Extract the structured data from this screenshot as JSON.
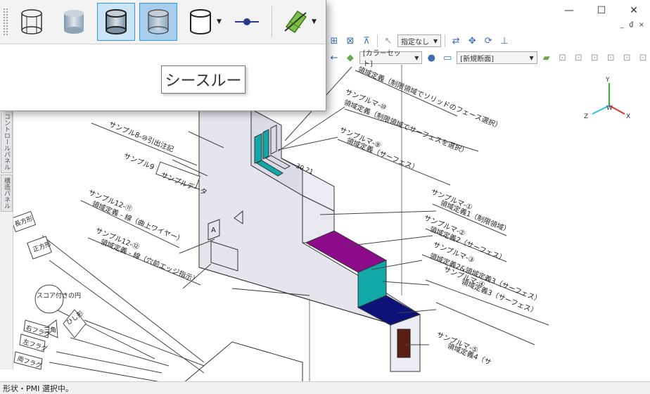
{
  "window": {
    "minimize": "—",
    "maximize": "☐",
    "close": "✕",
    "inner_controls": "_ ₫ ×"
  },
  "toolbar": {
    "specify_dropdown": "指定なし",
    "color_set": "[カラーセット]",
    "new_section": "[新規断面]"
  },
  "popup": {
    "tooltip": "シースルー",
    "buttons": [
      {
        "name": "wireframe",
        "active": false
      },
      {
        "name": "shaded",
        "active": false
      },
      {
        "name": "shaded-with-edges",
        "active": true
      },
      {
        "name": "see-through",
        "active": true
      }
    ]
  },
  "side_panel": {
    "tabs": [
      "コントロールパネル",
      "構造パネル"
    ]
  },
  "drawing": {
    "labels": [
      "領域定義（制限領域でソリッドのフェース選択）",
      "サンプルマ-⑩",
      "領域定義（制限領域でサーフェスを選択）",
      "サンプルマ-⑨",
      "領域定義（サーフェス）",
      "サンプル8-⑩引出注記",
      "サンプル9",
      "サンプルデータ",
      "サンプル12-⑪",
      "領域定義 - 線（曲上ワイヤー）",
      "サンプル12-⑫",
      "領域定義 - 線（穴前エッジ指示）",
      "サンプルマ-①",
      "領域定義1（制限領域）",
      "サンプルマ-②",
      "領域定義2（サーフェス）",
      "サンプルマ-③",
      "領域定義2&領域定義3（サーフェス）",
      "サンプルマ-④",
      "領域定義3（サーフェス）",
      "サンプルマ-⑤",
      "領域定義4（サ",
      "長方形",
      "正方形",
      "スコア付きの円",
      "ひし形",
      "三角",
      "右フラグ",
      "左フラグ",
      "両フラグ",
      "A",
      "30.21"
    ],
    "axes": {
      "x": "X",
      "y": "Y",
      "z": "Z",
      "w": "W"
    },
    "colors": {
      "purple": "#8b0b8b",
      "teal": "#12a8a8",
      "navy": "#0c127a",
      "brown": "#5a1f14",
      "body": "#e5e5ee"
    }
  },
  "status": {
    "text": "形状・PMI 選択中。"
  }
}
